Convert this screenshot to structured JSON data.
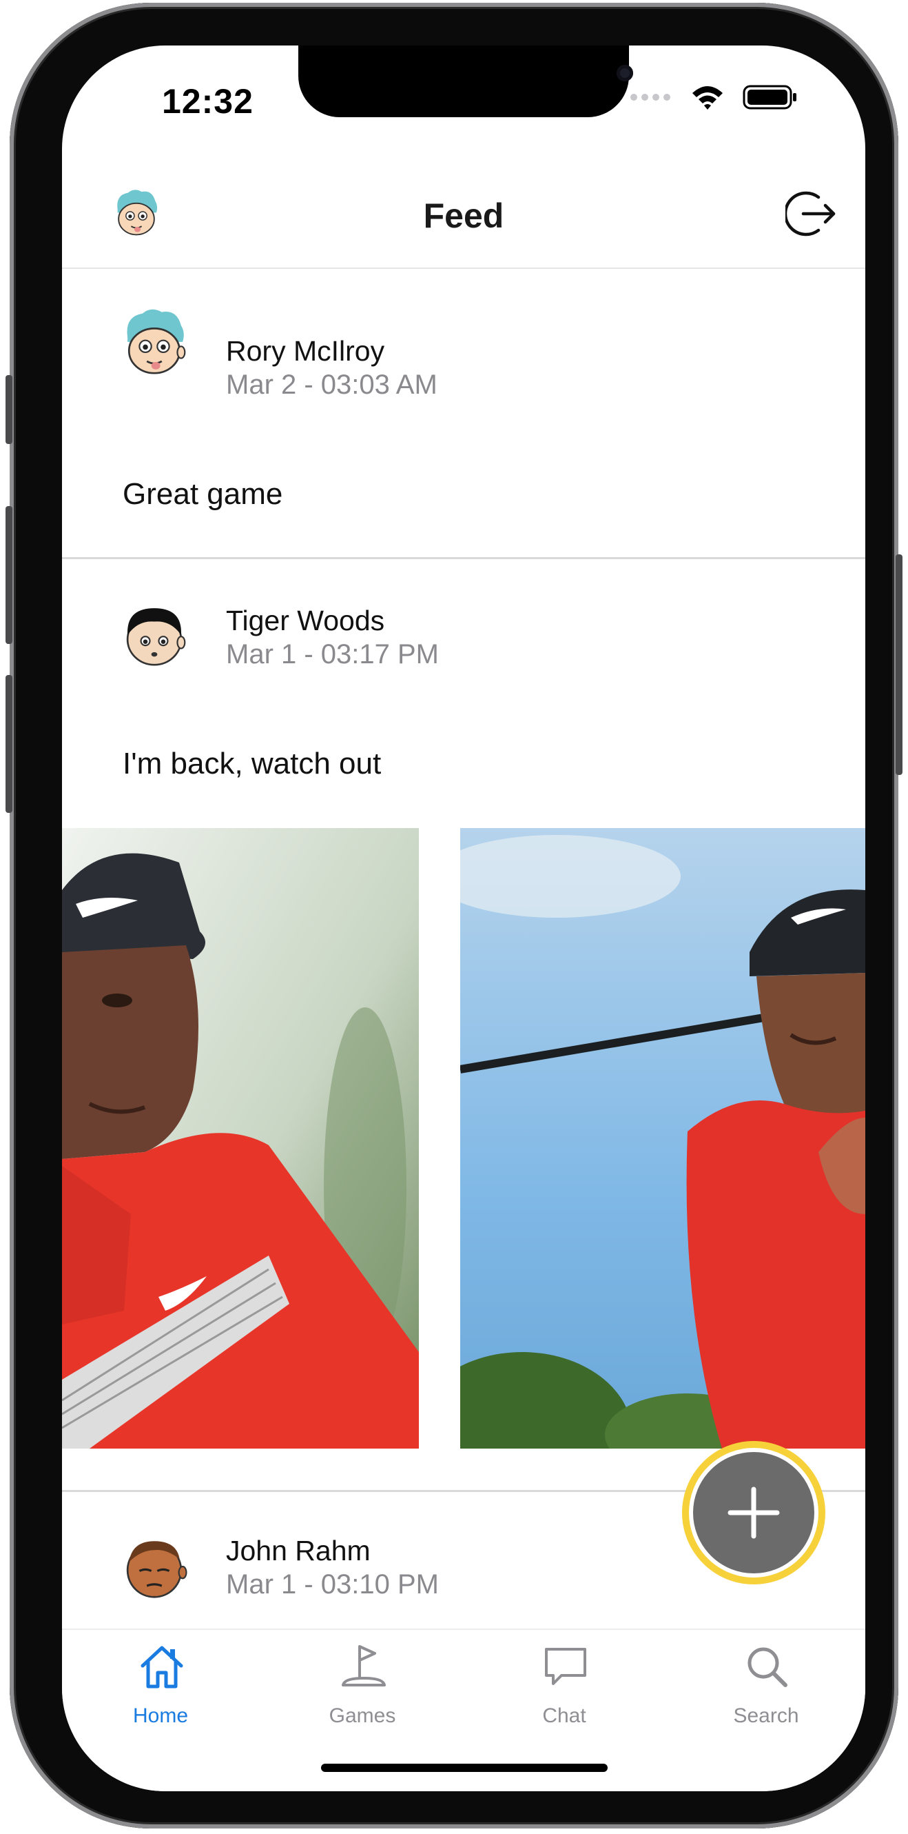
{
  "status_bar": {
    "time": "12:32"
  },
  "header": {
    "title": "Feed"
  },
  "posts": [
    {
      "author": "Rory McIlroy",
      "date": "Mar 2 - 03:03 AM",
      "text": "Great game"
    },
    {
      "author": "Tiger Woods",
      "date": "Mar 1 - 03:17 PM",
      "text": "I'm back, watch out"
    },
    {
      "author": "John Rahm",
      "date": "Mar 1 - 03:10 PM",
      "text": ""
    }
  ],
  "tabs": [
    {
      "label": "Home",
      "icon": "house-icon",
      "active": true
    },
    {
      "label": "Games",
      "icon": "golf-flag-icon",
      "active": false
    },
    {
      "label": "Chat",
      "icon": "chat-bubble-icon",
      "active": false
    },
    {
      "label": "Search",
      "icon": "magnifier-icon",
      "active": false
    }
  ],
  "fab": {
    "icon": "plus-icon"
  },
  "colors": {
    "accent": "#1a7be0",
    "fab_ring": "#f7d13a",
    "fab": "#6b6b6b",
    "secondary_text": "#8a8a8e"
  }
}
